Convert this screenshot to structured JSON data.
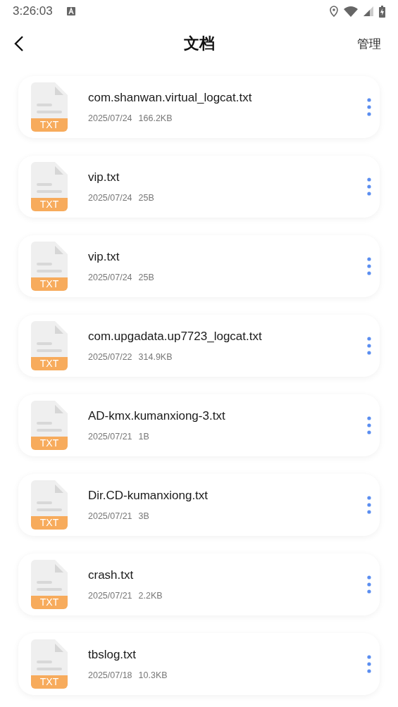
{
  "status_bar": {
    "time": "3:26:03"
  },
  "header": {
    "title": "文档",
    "action": "管理"
  },
  "files": [
    {
      "name": "com.shanwan.virtual_logcat.txt",
      "date": "2025/07/24",
      "size": "166.2KB",
      "type": "TXT"
    },
    {
      "name": "vip.txt",
      "date": "2025/07/24",
      "size": "25B",
      "type": "TXT"
    },
    {
      "name": "vip.txt",
      "date": "2025/07/24",
      "size": "25B",
      "type": "TXT"
    },
    {
      "name": "com.upgadata.up7723_logcat.txt",
      "date": "2025/07/22",
      "size": "314.9KB",
      "type": "TXT"
    },
    {
      "name": "AD-kmx.kumanxiong-3.txt",
      "date": "2025/07/21",
      "size": "1B",
      "type": "TXT"
    },
    {
      "name": "Dir.CD-kumanxiong.txt",
      "date": "2025/07/21",
      "size": "3B",
      "type": "TXT"
    },
    {
      "name": "crash.txt",
      "date": "2025/07/21",
      "size": "2.2KB",
      "type": "TXT"
    },
    {
      "name": "tbslog.txt",
      "date": "2025/07/18",
      "size": "10.3KB",
      "type": "TXT"
    }
  ]
}
